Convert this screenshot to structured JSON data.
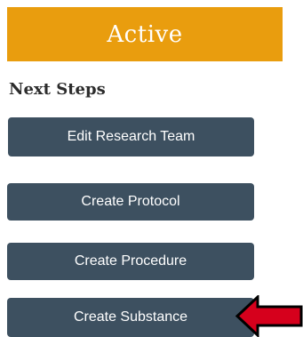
{
  "status": {
    "label": "Active",
    "color": "#e99d0e"
  },
  "next_steps": {
    "heading": "Next Steps",
    "buttons": [
      {
        "label": "Edit Research Team"
      },
      {
        "label": "Create Protocol"
      },
      {
        "label": "Create Procedure"
      },
      {
        "label": "Create Substance"
      }
    ],
    "button_color": "#3d5060"
  },
  "annotation": {
    "icon": "red-arrow-icon",
    "color": "#d6001c",
    "points_to": "Create Substance"
  }
}
